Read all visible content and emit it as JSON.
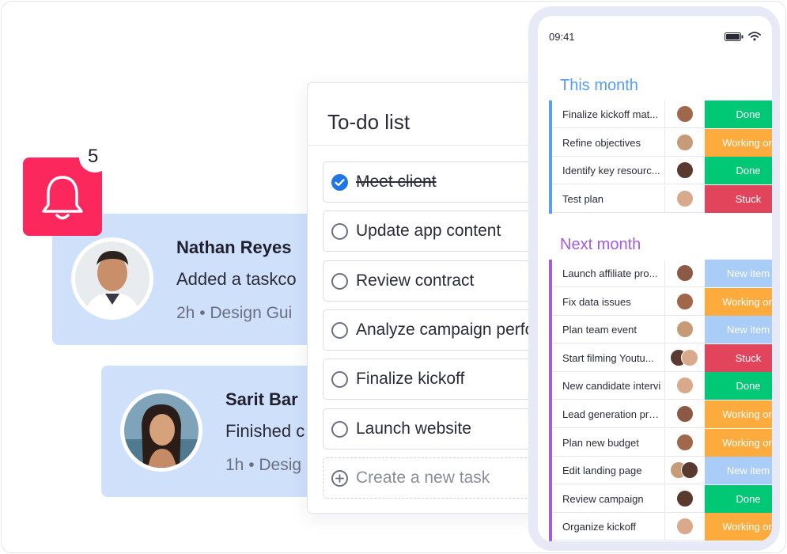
{
  "colors": {
    "done": "#00c875",
    "working": "#fdab3d",
    "stuck": "#e2445c",
    "new_item": "#a9cdf7",
    "this_month": "#579bfc",
    "next_month": "#a25ddc",
    "bell": "#fb275d",
    "card": "#cfe0fb"
  },
  "notification": {
    "bell_icon": "bell-icon",
    "count": "5"
  },
  "cards": [
    {
      "name": "Nathan Reyes",
      "message": "Added a taskco",
      "meta": "2h • Design Gui"
    },
    {
      "name": "Sarit Bar ",
      "message": "Finished c",
      "meta": "1h • Desig"
    }
  ],
  "todo": {
    "title": "To-do list",
    "tasks": [
      {
        "label": "Meet client",
        "done": true
      },
      {
        "label": "Update app content",
        "done": false
      },
      {
        "label": "Review contract",
        "done": false
      },
      {
        "label": "Analyze campaign perfo",
        "done": false
      },
      {
        "label": "Finalize kickoff",
        "done": false
      },
      {
        "label": "Launch website",
        "done": false
      }
    ],
    "create_label": "Create a new task"
  },
  "phone": {
    "time": "09:41",
    "groups": [
      {
        "title": "This month",
        "rows": [
          {
            "task": "Finalize kickoff mat...",
            "status": "Done",
            "kind": "done",
            "people": 1
          },
          {
            "task": "Refine objectives",
            "status": "Working on",
            "kind": "working",
            "people": 1
          },
          {
            "task": "Identify key resourc...",
            "status": "Done",
            "kind": "done",
            "people": 1
          },
          {
            "task": "Test plan",
            "status": "Stuck",
            "kind": "stuck",
            "people": 1
          }
        ]
      },
      {
        "title": "Next month",
        "rows": [
          {
            "task": "Launch affiliate pro...",
            "status": "New item",
            "kind": "new_item",
            "people": 1
          },
          {
            "task": "Fix data issues",
            "status": "Working on",
            "kind": "working",
            "people": 1
          },
          {
            "task": "Plan team event",
            "status": "New item",
            "kind": "new_item",
            "people": 1
          },
          {
            "task": "Start filming Youtu...",
            "status": "Stuck",
            "kind": "stuck",
            "people": 2
          },
          {
            "task": "New candidate intervi",
            "status": "Done",
            "kind": "done",
            "people": 1
          },
          {
            "task": "Lead generation prese",
            "status": "Working on",
            "kind": "working",
            "people": 1
          },
          {
            "task": "Plan new budget",
            "status": "Working on",
            "kind": "working",
            "people": 1
          },
          {
            "task": "Edit landing page",
            "status": "New item",
            "kind": "new_item",
            "people": 2
          },
          {
            "task": "Review campaign",
            "status": "Done",
            "kind": "done",
            "people": 1
          },
          {
            "task": "Organize kickoff",
            "status": "Working on",
            "kind": "working",
            "people": 1
          }
        ]
      }
    ]
  }
}
